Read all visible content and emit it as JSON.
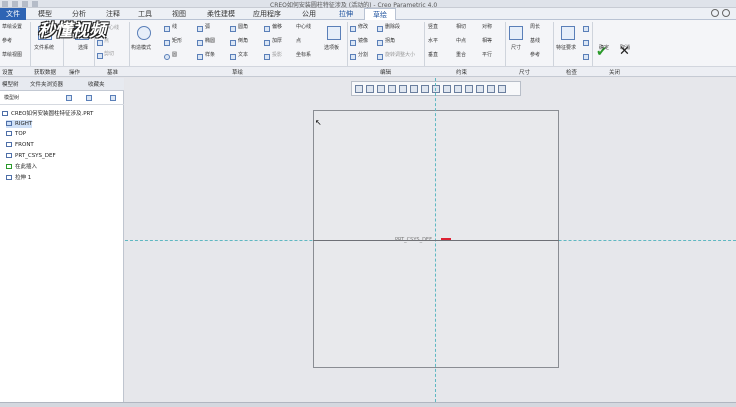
{
  "window": {
    "title": "CREO如何安装圆柱特征涉及 (活动的) - Creo Parametric 4.0"
  },
  "tabs": [
    {
      "label": "文件"
    },
    {
      "label": "模型"
    },
    {
      "label": "分析"
    },
    {
      "label": "注释"
    },
    {
      "label": "工具"
    },
    {
      "label": "视图"
    },
    {
      "label": "柔性建模"
    },
    {
      "label": "应用程序"
    },
    {
      "label": "公用"
    },
    {
      "label": "拉伸"
    },
    {
      "label": "草绘"
    }
  ],
  "ribbon": {
    "setup": {
      "items": [
        "草绘设置",
        "参考",
        "草绘视图"
      ],
      "group": "设置"
    },
    "get_data": {
      "item": "文件系统",
      "group": "获取数据"
    },
    "operations": {
      "items": [
        "选择",
        "剪切"
      ],
      "group": "操作"
    },
    "datum": {
      "items": [
        "中心线",
        "点",
        "坐标系"
      ],
      "group": "基准"
    },
    "sketch": {
      "construction_mode": "构造模式",
      "items": [
        "线",
        "矩形",
        "圆",
        "弧",
        "椭圆",
        "样条",
        "圆角",
        "倒角",
        "文本",
        "偏移",
        "加厚",
        "投影",
        "中心线",
        "点",
        "坐标系",
        "选项板"
      ],
      "group": "草绘"
    },
    "edit": {
      "items": [
        "修改",
        "删除段",
        "镜像",
        "拐角",
        "分割",
        "旋转调整大小"
      ],
      "group": "编辑"
    },
    "constrain": {
      "items": [
        "竖直",
        "相切",
        "对称",
        "水平",
        "中点",
        "相等",
        "垂直",
        "重合",
        "平行"
      ],
      "group": "约束"
    },
    "dimension": {
      "items": [
        "尺寸",
        "周长",
        "基线",
        "参考"
      ],
      "group": "尺寸"
    },
    "inspect": {
      "items": [
        "特征要求"
      ],
      "group": "检查"
    },
    "close": {
      "ok": "确定",
      "cancel": "取消",
      "group": "关闭"
    }
  },
  "sidebar": {
    "tabs": [
      "模型树",
      "文件夹浏览器",
      "收藏夹"
    ],
    "tree_header": "模型树",
    "items": [
      {
        "label": "CREO如何安装圆柱特征涉及.PRT"
      },
      {
        "label": "RIGHT"
      },
      {
        "label": "TOP"
      },
      {
        "label": "FRONT"
      },
      {
        "label": "PRT_CSYS_DEF"
      },
      {
        "label": "在此插入"
      },
      {
        "label": "拉伸 1"
      }
    ]
  },
  "canvas": {
    "csys_label": "PRT_CSYS_DEF"
  },
  "watermark": {
    "text": "秒懂视频"
  },
  "colors": {
    "file_tab": "#2e64b4",
    "accept": "#2a9a2a",
    "datum_line": "#5fb8c2"
  }
}
